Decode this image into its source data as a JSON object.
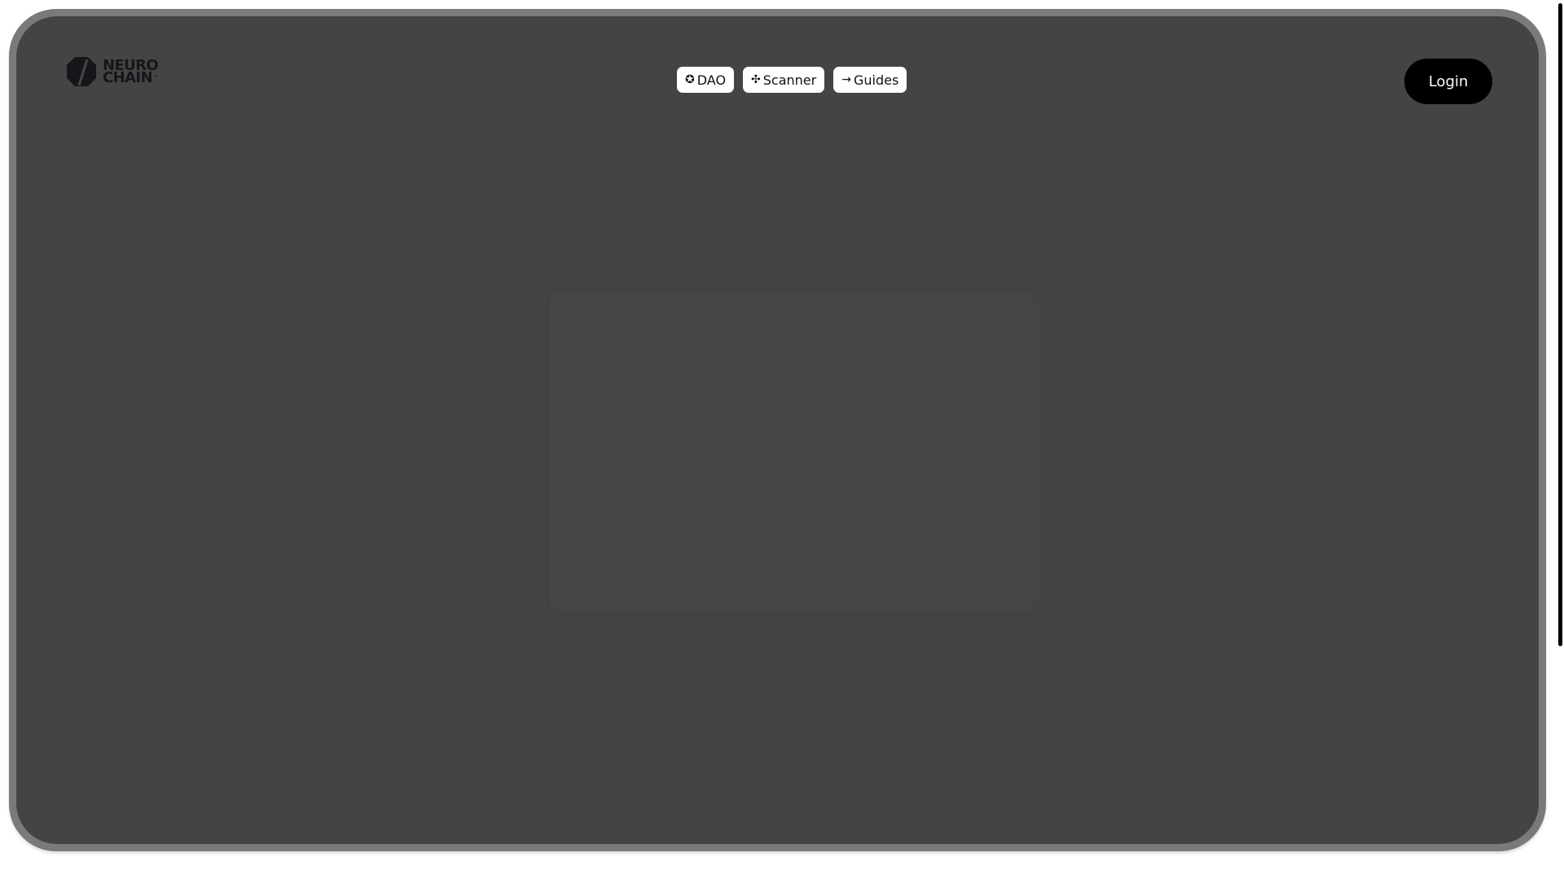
{
  "brand": {
    "line1": "NEURO",
    "line2": "CHAIN",
    "trademark": "™",
    "icon": "neurochain-logo-icon"
  },
  "nav": {
    "items": [
      {
        "icon_glyph": "✪",
        "icon": "dao-icon",
        "label": "DAO"
      },
      {
        "icon_glyph": "✣",
        "icon": "scanner-icon",
        "label": "Scanner"
      },
      {
        "icon_glyph": "→",
        "icon": "arrow-right-icon",
        "label": "Guides"
      }
    ]
  },
  "header": {
    "login_label": "Login"
  },
  "colors": {
    "page_background": "#ffffff",
    "frame_border": "#7a7a7a",
    "panel_background": "#444444",
    "pill_background": "#ffffff",
    "login_background": "#000000",
    "login_text": "#ffffff",
    "logo_color": "#15161a"
  }
}
